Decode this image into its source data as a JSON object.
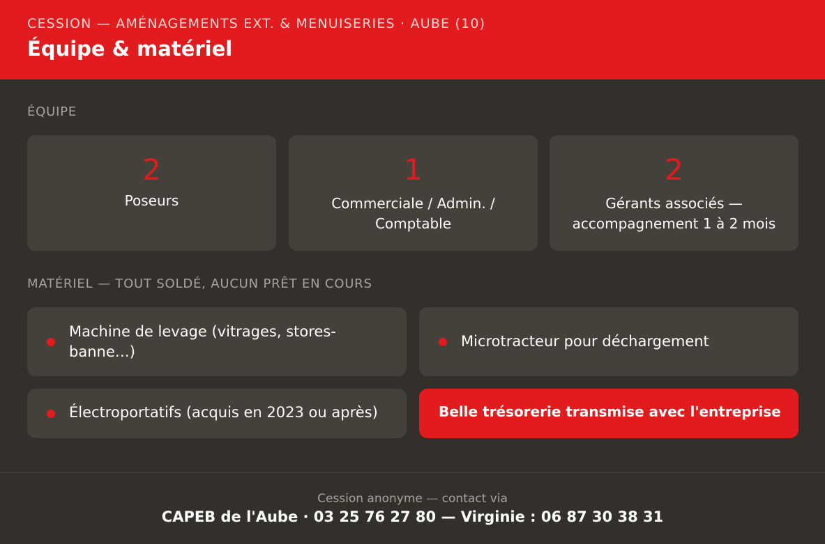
{
  "header": {
    "kicker": "CESSION — AMÉNAGEMENTS EXT. & MENUISERIES · AUBE (10)",
    "title": "Équipe & matériel"
  },
  "colors": {
    "accent": "#e21b1e",
    "background": "#33302b",
    "card": "#44403a",
    "muted_text": "#a8a39a"
  },
  "team": {
    "section_label": "ÉQUIPE",
    "cards": [
      {
        "number": "2",
        "label": "Poseurs"
      },
      {
        "number": "1",
        "label": "Commerciale / Admin. / Comptable"
      },
      {
        "number": "2",
        "label": "Gérants associés — accompagnement 1 à 2 mois"
      }
    ]
  },
  "equipment": {
    "section_label": "MATÉRIEL — TOUT SOLDÉ, AUCUN PRÊT EN COURS",
    "items": [
      {
        "label": "Machine de levage (vitrages, stores-banne…)",
        "bullet_icon": "red-dot-icon"
      },
      {
        "label": "Microtracteur pour déchargement",
        "bullet_icon": "red-dot-icon"
      },
      {
        "label": "Électroportatifs (acquis en 2023 ou après)",
        "bullet_icon": "red-dot-icon"
      }
    ],
    "highlight": "Belle trésorerie transmise avec l'entreprise"
  },
  "footer": {
    "line1": "Cession anonyme — contact via",
    "line2": "CAPEB de l'Aube · 03 25 76 27 80 — Virginie : 06 87 30 38 31"
  }
}
